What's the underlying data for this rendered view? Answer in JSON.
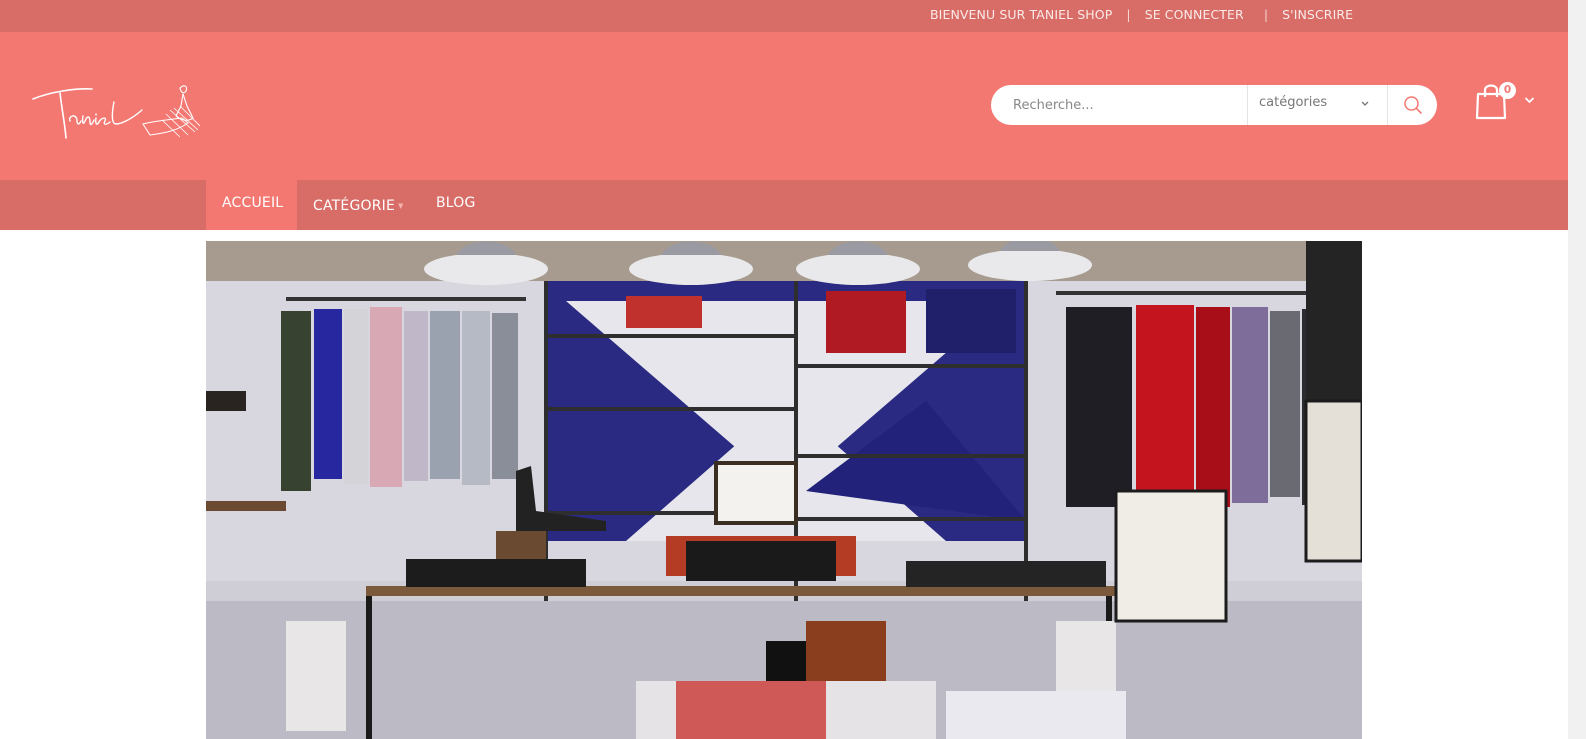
{
  "topbar": {
    "welcome": "BIENVENU SUR TANIEL SHOP",
    "separator": "|",
    "login": "SE CONNECTER",
    "register": "S'INSCRIRE"
  },
  "header": {
    "logo_text": "Taniel",
    "search": {
      "placeholder": "Recherche..."
    },
    "category_select": {
      "selected": "catégories"
    },
    "cart_count": "0"
  },
  "nav": {
    "items": [
      {
        "label": "ACCUEIL",
        "active": true
      },
      {
        "label": "CATÉGORIE",
        "has_dropdown": true
      },
      {
        "label": "BLOG"
      }
    ]
  },
  "colors": {
    "topbar": "#d86c67",
    "header": "#f47872",
    "nav": "#d86c67",
    "nav_active": "#f47872"
  },
  "icons": {
    "search": "search-icon",
    "cart": "shopping-bag-icon",
    "dropdown": "chevron-down-icon"
  }
}
